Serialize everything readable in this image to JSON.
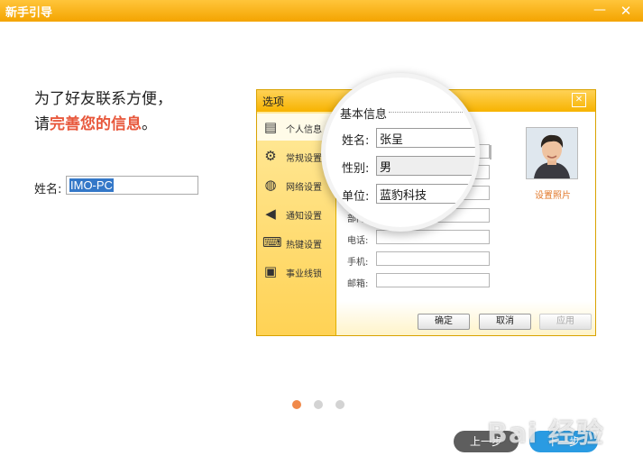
{
  "window": {
    "title": "新手引导",
    "minimize_symbol": "—",
    "close_symbol": "✕"
  },
  "intro": {
    "line1": "为了好友联系方便，",
    "line2_prefix": "请",
    "line2_accent": "完善您的信息",
    "line2_suffix": "。"
  },
  "name_field": {
    "label": "姓名:",
    "value": "IMO-PC"
  },
  "illustration": {
    "dialog_title": "选项",
    "close_symbol": "✕",
    "sidebar": [
      {
        "label": "个人信息",
        "icon": "id-card-icon",
        "glyph": "▤"
      },
      {
        "label": "常规设置",
        "icon": "gear-icon",
        "glyph": "⚙"
      },
      {
        "label": "网络设置",
        "icon": "globe-icon",
        "glyph": "◍"
      },
      {
        "label": "通知设置",
        "icon": "speaker-icon",
        "glyph": "◀"
      },
      {
        "label": "热键设置",
        "icon": "keyboard-icon",
        "glyph": "⌨"
      },
      {
        "label": "事业线锁",
        "icon": "lock-icon",
        "glyph": "▣"
      }
    ],
    "fields": [
      {
        "label": "部门"
      },
      {
        "label": "电话:"
      },
      {
        "label": "手机:"
      },
      {
        "label": "邮箱:"
      }
    ],
    "photo_link": "设置照片",
    "buttons": {
      "ok": "确定",
      "cancel": "取消",
      "apply": "应用"
    },
    "magnifier": {
      "section_title": "基本信息",
      "name_label": "姓名:",
      "name_value": "张呈",
      "gender_label": "性别:",
      "gender_value": "男",
      "unit_label": "单位:",
      "unit_value": "蓝豹科技"
    }
  },
  "pager": {
    "count": 3,
    "active_index": 0
  },
  "footer": {
    "prev_label": "上一步",
    "next_label": "下一步"
  },
  "watermark": "Bai 经验",
  "colors": {
    "title_bar": "#f7b000",
    "accent_text": "#e8583c",
    "next_button": "#2a9be2",
    "prev_button": "#5e5e5e",
    "active_dot": "#f0894a"
  }
}
